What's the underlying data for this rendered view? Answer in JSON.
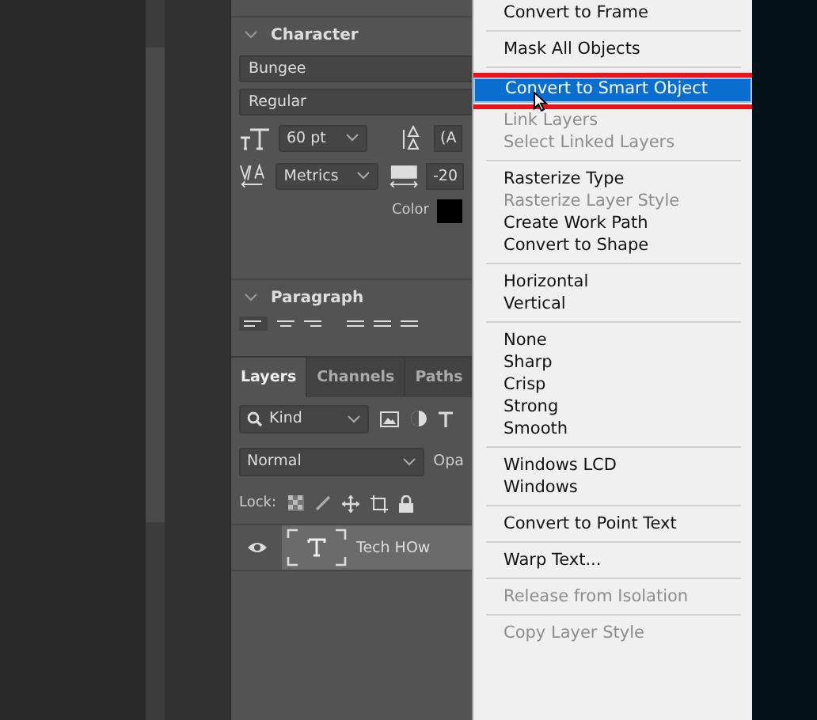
{
  "character": {
    "title": "Character",
    "expanded": true,
    "font_family": "Bungee",
    "font_style": "Regular",
    "size": "60 pt",
    "leading": "(A",
    "kerning": "Metrics",
    "tracking": "-20",
    "color_label": "Color"
  },
  "paragraph": {
    "title": "Paragraph",
    "expanded": true
  },
  "layers_panel": {
    "tabs": [
      {
        "label": "Layers",
        "selected": true
      },
      {
        "label": "Channels",
        "selected": false
      },
      {
        "label": "Paths",
        "selected": false
      }
    ],
    "filter": "Kind",
    "blend_mode": "Normal",
    "opacity_label": "Opa",
    "lock_label": "Lock:",
    "layers": [
      {
        "name": "Tech HOw",
        "visible": true,
        "selected": true
      }
    ]
  },
  "context_menu": [
    {
      "kind": "item",
      "label": "Convert to Frame",
      "disabled": false,
      "selected": false
    },
    {
      "kind": "separator"
    },
    {
      "kind": "item",
      "label": "Mask All Objects",
      "disabled": false,
      "selected": false
    },
    {
      "kind": "separator"
    },
    {
      "kind": "item",
      "label": "Convert to Smart Object",
      "disabled": false,
      "selected": true
    },
    {
      "kind": "item",
      "label": "Link Layers",
      "disabled": true,
      "selected": false
    },
    {
      "kind": "item",
      "label": "Select Linked Layers",
      "disabled": true,
      "selected": false
    },
    {
      "kind": "separator"
    },
    {
      "kind": "item",
      "label": "Rasterize Type",
      "disabled": false,
      "selected": false
    },
    {
      "kind": "item",
      "label": "Rasterize Layer Style",
      "disabled": true,
      "selected": false
    },
    {
      "kind": "item",
      "label": "Create Work Path",
      "disabled": false,
      "selected": false
    },
    {
      "kind": "item",
      "label": "Convert to Shape",
      "disabled": false,
      "selected": false
    },
    {
      "kind": "separator"
    },
    {
      "kind": "item",
      "label": "Horizontal",
      "disabled": false,
      "selected": false
    },
    {
      "kind": "item",
      "label": "Vertical",
      "disabled": false,
      "selected": false
    },
    {
      "kind": "separator"
    },
    {
      "kind": "item",
      "label": "None",
      "disabled": false,
      "selected": false
    },
    {
      "kind": "item",
      "label": "Sharp",
      "disabled": false,
      "selected": false
    },
    {
      "kind": "item",
      "label": "Crisp",
      "disabled": false,
      "selected": false
    },
    {
      "kind": "item",
      "label": "Strong",
      "disabled": false,
      "selected": false
    },
    {
      "kind": "item",
      "label": "Smooth",
      "disabled": false,
      "selected": false
    },
    {
      "kind": "separator"
    },
    {
      "kind": "item",
      "label": "Windows LCD",
      "disabled": false,
      "selected": false
    },
    {
      "kind": "item",
      "label": "Windows",
      "disabled": false,
      "selected": false
    },
    {
      "kind": "separator"
    },
    {
      "kind": "item",
      "label": "Convert to Point Text",
      "disabled": false,
      "selected": false
    },
    {
      "kind": "separator"
    },
    {
      "kind": "item",
      "label": "Warp Text...",
      "disabled": false,
      "selected": false
    },
    {
      "kind": "separator"
    },
    {
      "kind": "item",
      "label": "Release from Isolation",
      "disabled": true,
      "selected": false
    },
    {
      "kind": "separator"
    },
    {
      "kind": "item",
      "label": "Copy Layer Style",
      "disabled": true,
      "selected": false
    }
  ]
}
